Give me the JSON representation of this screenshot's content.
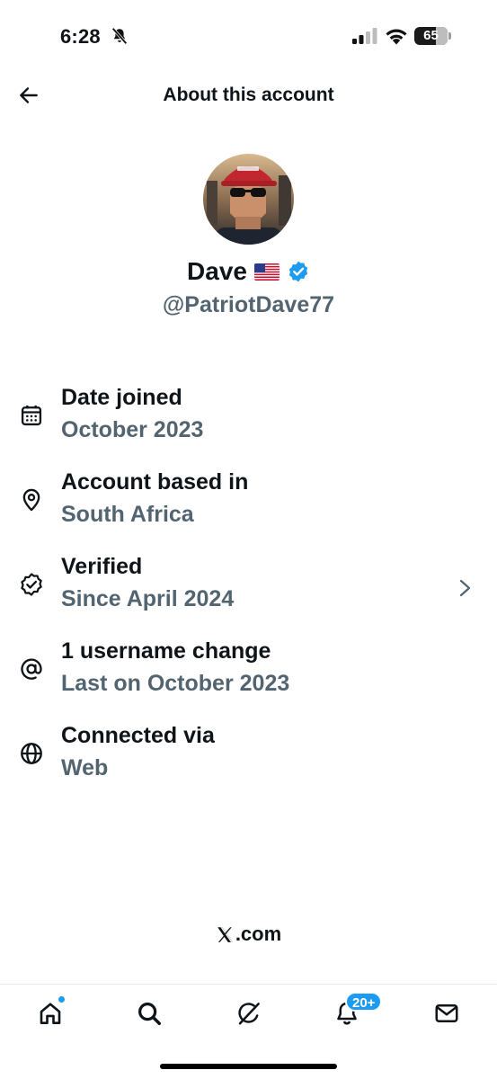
{
  "status_bar": {
    "time": "6:28",
    "battery_level": "65",
    "battery_percent": 65,
    "mute_icon": "bell-slash-icon",
    "signal_icon": "cellular-signal-icon",
    "wifi_icon": "wifi-icon"
  },
  "header": {
    "title": "About this account",
    "back_icon": "arrow-left-icon"
  },
  "profile": {
    "display_name": "Dave",
    "flag_icon": "us-flag-icon",
    "verified_icon": "verified-badge-icon",
    "handle": "@PatriotDave77"
  },
  "info_rows": [
    {
      "icon": "calendar-icon",
      "title": "Date joined",
      "value": "October 2023"
    },
    {
      "icon": "location-pin-icon",
      "title": "Account based in",
      "value": "South Africa"
    },
    {
      "icon": "verified-outline-icon",
      "title": "Verified",
      "value": "Since April 2024",
      "has_chevron": true
    },
    {
      "icon": "at-sign-icon",
      "title": "1 username change",
      "value": "Last on October 2023"
    },
    {
      "icon": "globe-icon",
      "title": "Connected via",
      "value": "Web"
    }
  ],
  "footer": {
    "brand_logo": "x-logo-icon",
    "brand_suffix": ".com"
  },
  "tab_bar": {
    "items": [
      {
        "name": "home",
        "icon": "home-icon",
        "badge": "dot"
      },
      {
        "name": "search",
        "icon": "search-icon"
      },
      {
        "name": "grok",
        "icon": "grok-icon"
      },
      {
        "name": "notifications",
        "icon": "bell-icon",
        "badge": "20+"
      },
      {
        "name": "messages",
        "icon": "envelope-icon"
      }
    ]
  },
  "colors": {
    "primary_text": "#0f1419",
    "secondary_text": "#536471",
    "accent": "#1d9bf0",
    "background": "#ffffff"
  }
}
